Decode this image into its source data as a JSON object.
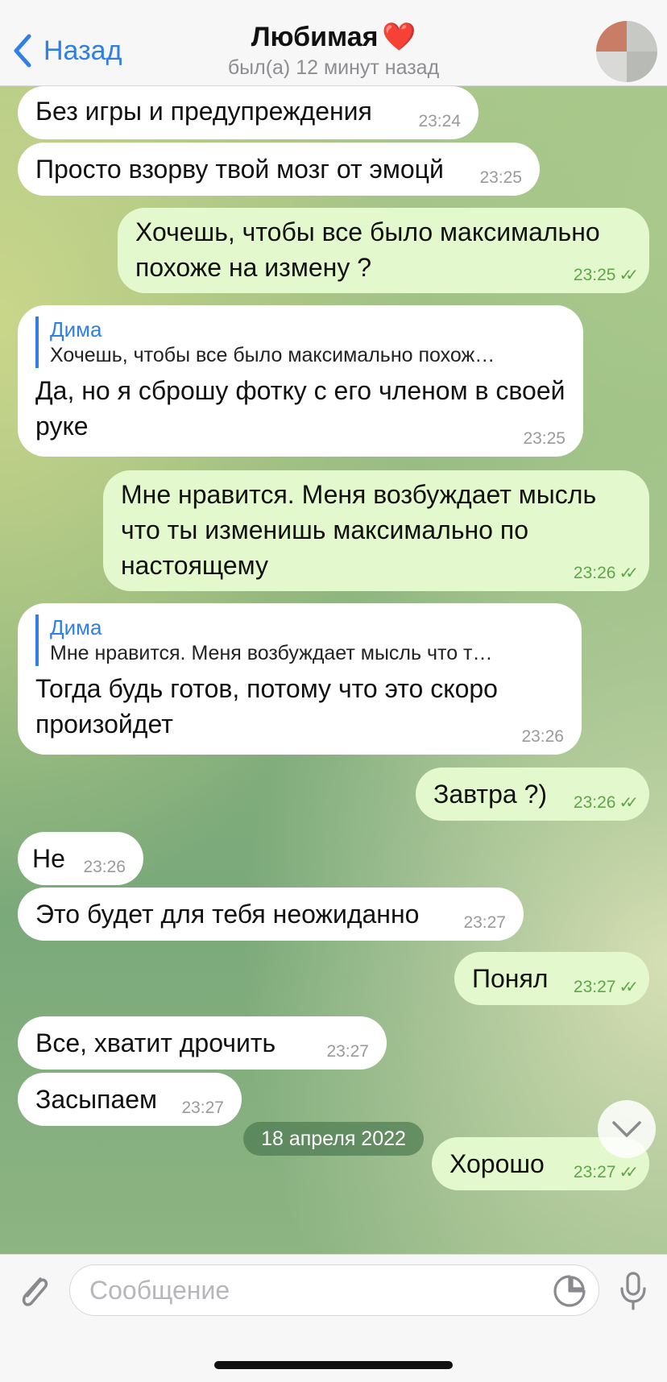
{
  "header": {
    "back_label": "Назад",
    "title": "Любимая",
    "title_emoji": "❤️",
    "subtitle": "был(а) 12 минут назад"
  },
  "messages": [
    {
      "dir": "in",
      "text": "Без игры и предупреждения",
      "time": "23:24"
    },
    {
      "dir": "in",
      "text": "Просто взорву твой мозг от эмоцй",
      "time": "23:25"
    },
    {
      "dir": "out",
      "text": "Хочешь, чтобы все было максимально похоже на измену ?",
      "time": "23:25"
    },
    {
      "dir": "in",
      "reply_name": "Дима",
      "reply_text": "Хочешь, чтобы все было максимально похож…",
      "text": "Да, но я сброшу фотку с его членом в своей руке",
      "time": "23:25"
    },
    {
      "dir": "out",
      "text": "Мне нравится. Меня возбуждает мысль что ты изменишь максимально по настоящему",
      "time": "23:26"
    },
    {
      "dir": "in",
      "reply_name": "Дима",
      "reply_text": "Мне нравится. Меня возбуждает мысль что т…",
      "text": "Тогда будь готов, потому что это скоро произойдет",
      "time": "23:26"
    },
    {
      "dir": "out",
      "text": "Завтра ?)",
      "time": "23:26"
    },
    {
      "dir": "in",
      "text": "Не",
      "time": "23:26"
    },
    {
      "dir": "in",
      "text": "Это будет для тебя неожиданно",
      "time": "23:27"
    },
    {
      "dir": "out",
      "text": "Понял",
      "time": "23:27"
    },
    {
      "dir": "in",
      "text": "Все, хватит дрочить",
      "time": "23:27"
    },
    {
      "dir": "in",
      "text": "Засыпаем",
      "time": "23:27"
    },
    {
      "dir": "out",
      "text": "Хорошо",
      "time": "23:27"
    }
  ],
  "read_ticks": "✓✓",
  "date_pill": "18 апреля 2022",
  "input": {
    "placeholder": "Сообщение"
  },
  "icons": {
    "back": "chevron-left-icon",
    "attach": "paperclip-icon",
    "sticker": "sticker-icon",
    "mic": "microphone-icon",
    "scroll_down": "chevron-down-icon"
  },
  "colors": {
    "accent": "#2f7fe4",
    "outgoing_bubble": "#e4f8cd",
    "incoming_bubble": "#ffffff",
    "read_ticks": "#5fa64a",
    "heart": "#e0262e"
  }
}
